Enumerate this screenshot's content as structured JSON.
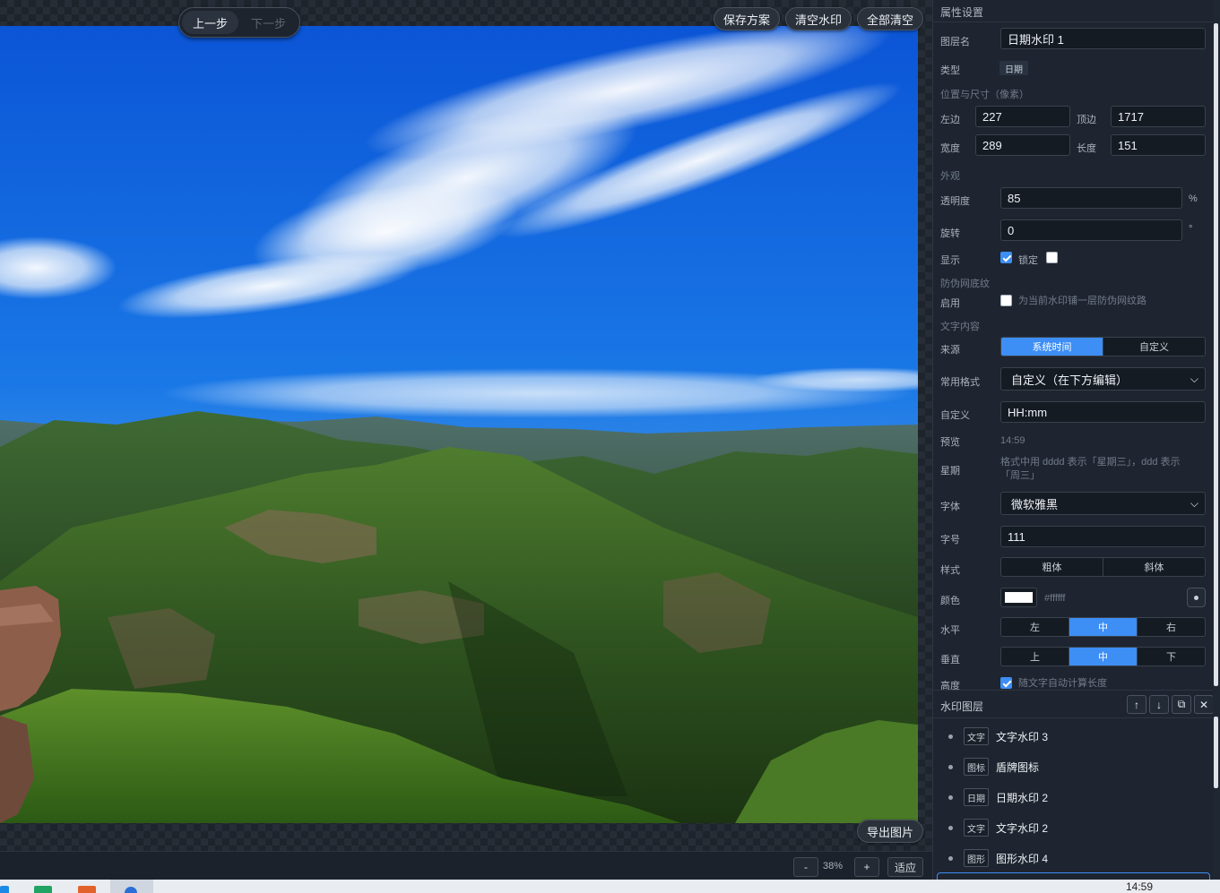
{
  "toolbar": {
    "undo": "上一步",
    "redo": "下一步",
    "save_scheme": "保存方案",
    "clear_watermark": "清空水印",
    "clear_all": "全部清空",
    "export_image": "导出图片"
  },
  "zoom": {
    "minus": "-",
    "level": "38%",
    "plus": "+",
    "fit": "适应"
  },
  "properties": {
    "title": "属性设置",
    "layer_name_label": "图层名",
    "layer_name_value": "日期水印 1",
    "type_label": "类型",
    "type_value": "日期",
    "pos_size_section": "位置与尺寸（像素）",
    "left_label": "左边",
    "left_value": "227",
    "top_label": "顶边",
    "top_value": "1717",
    "width_label": "宽度",
    "width_value": "289",
    "length_label": "长度",
    "length_value": "151",
    "appearance_section": "外观",
    "opacity_label": "透明度",
    "opacity_value": "85",
    "opacity_unit": "%",
    "rotation_label": "旋转",
    "rotation_value": "0",
    "rotation_unit": "°",
    "show_label": "显示",
    "lock_label": "锁定",
    "show_checked": true,
    "lock_checked": false,
    "anti_counterfeit_section": "防伪网底纹",
    "enable_label": "启用",
    "enable_hint": "为当前水印铺一层防伪网纹路",
    "text_content_section": "文字内容",
    "source_label": "来源",
    "source_options": [
      "系统时间",
      "自定义"
    ],
    "source_active": 0,
    "common_format_label": "常用格式",
    "common_format_value": "自定义（在下方编辑）",
    "custom_label": "自定义",
    "custom_value": "HH:mm",
    "preview_label": "预览",
    "preview_value": "14:59",
    "weekday_label": "星期",
    "weekday_hint": "格式中用 dddd 表示「星期三」，ddd 表示「周三」",
    "font_label": "字体",
    "font_value": "微软雅黑",
    "font_size_label": "字号",
    "font_size_value": "111",
    "style_label": "样式",
    "style_options": [
      "粗体",
      "斜体"
    ],
    "color_label": "颜色",
    "color_value": "#ffffff",
    "horizontal_label": "水平",
    "horizontal_options": [
      "左",
      "中",
      "右"
    ],
    "horizontal_active": 1,
    "vertical_label": "垂直",
    "vertical_options": [
      "上",
      "中",
      "下"
    ],
    "vertical_active": 1,
    "height_label": "高度",
    "height_hint": "随文字自动计算长度"
  },
  "layers": {
    "title": "水印图层",
    "items": [
      {
        "tag": "文字",
        "name": "文字水印 3"
      },
      {
        "tag": "图标",
        "name": "盾牌图标"
      },
      {
        "tag": "日期",
        "name": "日期水印 2"
      },
      {
        "tag": "文字",
        "name": "文字水印 2"
      },
      {
        "tag": "图形",
        "name": "图形水印 4"
      }
    ]
  },
  "taskbar": {
    "time": "14:59"
  },
  "colors": {
    "accent": "#3d8ef5",
    "panel_bg": "#1e2530",
    "sky": "#1565d8"
  }
}
